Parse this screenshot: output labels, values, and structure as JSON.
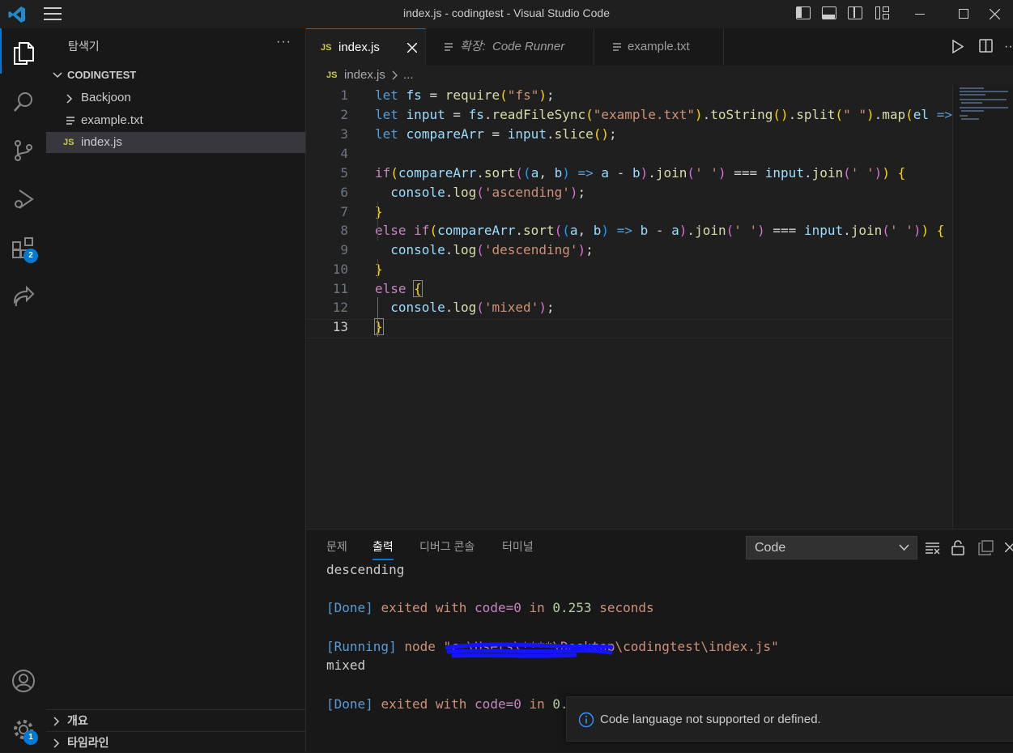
{
  "window": {
    "title": "index.js - codingtest - Visual Studio Code"
  },
  "activity_bar": {
    "extensions_badge": "2",
    "settings_badge": "1"
  },
  "sidebar": {
    "title": "탐색기",
    "more": "···",
    "folder": "CODINGTEST",
    "items": [
      {
        "label": "Backjoon",
        "type": "folder"
      },
      {
        "label": "example.txt",
        "type": "file"
      },
      {
        "label": "index.js",
        "type": "file",
        "badge": "JS",
        "selected": true
      }
    ],
    "sections": [
      "개요",
      "타임라인"
    ]
  },
  "tabs": [
    {
      "label": "index.js",
      "badge": "JS",
      "active": true
    },
    {
      "prefix": "확장:",
      "label": "Code Runner",
      "active": false
    },
    {
      "label": "example.txt",
      "active": false
    }
  ],
  "breadcrumb": {
    "badge": "JS",
    "file": "index.js",
    "rest": "..."
  },
  "editor": {
    "line_numbers": [
      "1",
      "2",
      "3",
      "4",
      "5",
      "6",
      "7",
      "8",
      "9",
      "10",
      "11",
      "12",
      "13"
    ],
    "lines": [
      "let fs = require(\"fs\");",
      "let input = fs.readFileSync(\"example.txt\").toString().split(\" \").map(el =>",
      "let compareArr = input.slice();",
      "",
      "if(compareArr.sort((a, b) => a - b).join(' ') === input.join(' ')) {",
      "  console.log('ascending');",
      "}",
      "else if(compareArr.sort((a, b) => b - a).join(' ') === input.join(' ')) {",
      "  console.log('descending');",
      "}",
      "else {",
      "  console.log('mixed');",
      "}"
    ],
    "current_line": "13"
  },
  "panel": {
    "tabs": [
      "문제",
      "출력",
      "디버그 콘솔",
      "터미널"
    ],
    "active_tab": "출력",
    "channel": "Code",
    "output": {
      "line1": "descending",
      "done1_tag": "[Done]",
      "done1_mid": "exited with",
      "done1_code": "code=0",
      "done1_in": "in",
      "done1_time": "0.253",
      "done1_unit": "seconds",
      "running_tag": "[Running]",
      "running_cmd": "node",
      "running_path": "\"c:\\Users\\****\\Desktop\\codingtest\\index.js\"",
      "line2": "mixed",
      "done2_tag": "[Done]",
      "done2_mid": "exited with",
      "done2_code": "code=0",
      "done2_in": "in",
      "done2_time": "0."
    }
  },
  "notification": {
    "message": "Code language not supported or defined."
  },
  "colors": {
    "accent": "#0078d4",
    "js_yellow": "#cbcb41"
  }
}
